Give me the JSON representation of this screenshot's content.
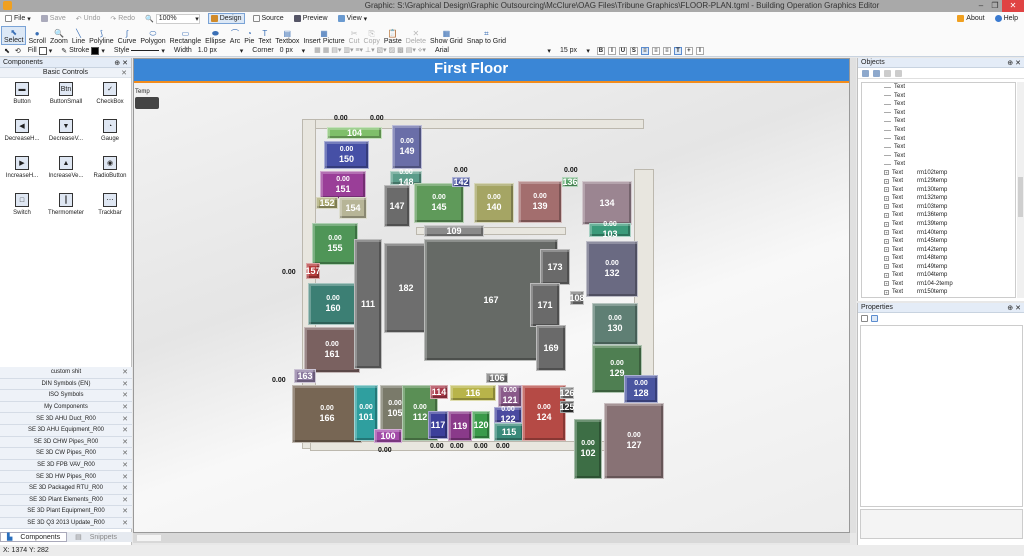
{
  "window": {
    "title": "Graphic: S:\\Graphical Design\\Graphic Outsourcing\\McClure\\OAG Files\\Tribune Graphics\\FLOOR-PLAN.tgml - Building Operation Graphics Editor",
    "minimize": "–",
    "maximize": "❐",
    "close": "✕"
  },
  "toolbar1": {
    "file": "File",
    "save": "Save",
    "undo": "Undo",
    "redo": "Redo",
    "zoom": "100%",
    "design": "Design",
    "source": "Source",
    "preview": "Preview",
    "view": "View",
    "about": "About",
    "help": "Help"
  },
  "tools": [
    {
      "label": "Select",
      "glyph": "⬉",
      "state": "active"
    },
    {
      "label": "Scroll",
      "glyph": "●",
      "state": "normal"
    },
    {
      "label": "Zoom",
      "glyph": "🔍",
      "state": "normal"
    },
    {
      "label": "Line",
      "glyph": "╲",
      "state": "normal"
    },
    {
      "label": "Polyline",
      "glyph": "⟆",
      "state": "normal"
    },
    {
      "label": "Curve",
      "glyph": "∫",
      "state": "normal"
    },
    {
      "label": "Polygon",
      "glyph": "⬭",
      "state": "normal"
    },
    {
      "label": "Rectangle",
      "glyph": "▭",
      "state": "normal"
    },
    {
      "label": "Ellipse",
      "glyph": "⬬",
      "state": "normal"
    },
    {
      "label": "Arc",
      "glyph": "⌒",
      "state": "normal"
    },
    {
      "label": "Pie",
      "glyph": "◔",
      "state": "normal"
    },
    {
      "label": "Text",
      "glyph": "T",
      "state": "normal"
    },
    {
      "label": "Textbox",
      "glyph": "▤",
      "state": "normal"
    },
    {
      "label": "Insert Picture",
      "glyph": "▦",
      "state": "normal"
    },
    {
      "label": "Cut",
      "glyph": "✂",
      "state": "disabled"
    },
    {
      "label": "Copy",
      "glyph": "⎘",
      "state": "disabled"
    },
    {
      "label": "Paste",
      "glyph": "📋",
      "state": "normal"
    },
    {
      "label": "Delete",
      "glyph": "✕",
      "state": "disabled"
    },
    {
      "label": "Show Grid",
      "glyph": "▦",
      "state": "normal"
    },
    {
      "label": "Snap to Grid",
      "glyph": "⌗",
      "state": "normal"
    }
  ],
  "toolbar3": {
    "fill": "Fill",
    "stroke": "Stroke",
    "style": "Style",
    "width_label": "Width",
    "width_value": "1.0 px",
    "corner_label": "Corner",
    "corner_value": "0 px",
    "font": "Arial",
    "font_size": "15 px",
    "format_buttons": [
      "B",
      "I",
      "U",
      "S",
      "≡",
      "≡",
      "≡",
      "T",
      "+",
      "I"
    ]
  },
  "components": {
    "title": "Components",
    "pin": "⊕",
    "close": "✕",
    "group": "Basic Controls",
    "controls": [
      {
        "label": "Button",
        "glyph": "▬"
      },
      {
        "label": "ButtonSmall",
        "glyph": "Btn"
      },
      {
        "label": "CheckBox",
        "glyph": "✓"
      },
      {
        "label": "DecreaseH...",
        "glyph": "◀"
      },
      {
        "label": "DecreaseV...",
        "glyph": "▼"
      },
      {
        "label": "Gauge",
        "glyph": "◔"
      },
      {
        "label": "IncreaseH...",
        "glyph": "▶"
      },
      {
        "label": "IncreaseVe...",
        "glyph": "▲"
      },
      {
        "label": "RadioButton",
        "glyph": "◉"
      },
      {
        "label": "Switch",
        "glyph": "□"
      },
      {
        "label": "Thermometer",
        "glyph": "┃"
      },
      {
        "label": "Trackbar",
        "glyph": "⋯"
      }
    ],
    "libraries": [
      "custom shit",
      "DIN Symbols (EN)",
      "ISO Symbols",
      "My Components",
      "SE 3D AHU Duct_R00",
      "SE 3D AHU Equipment_R00",
      "SE 3D CHW Pipes_R00",
      "SE 3D CW Pipes_R00",
      "SE 3D FPB VAV_R00",
      "SE 3D HW Pipes_R00",
      "SE 3D Packaged RTU_R00",
      "SE 3D Plant Elements_R00",
      "SE 3D Plant Equipment_R00",
      "SE 3D Q3 2013 Update_R00"
    ],
    "tabs": [
      "Components",
      "Snippets"
    ]
  },
  "status": {
    "coords": "X: 1374  Y: 282"
  },
  "canvas": {
    "banner_title": "First Floor",
    "temp_label": "Temp",
    "rooms": [
      {
        "n": "104",
        "v": "",
        "c": "#7fbf6a"
      },
      {
        "n": "149",
        "v": "0.00",
        "c": "#6a6ea8"
      },
      {
        "n": "150",
        "v": "0.00",
        "c": "#4650a6"
      },
      {
        "n": "148",
        "v": "0.00",
        "c": "#5b9c8a"
      },
      {
        "n": "151",
        "v": "0.00",
        "c": "#9a3e98"
      },
      {
        "n": "152",
        "v": "",
        "c": "#a8a770"
      },
      {
        "n": "154",
        "v": "",
        "c": "#b7b597"
      },
      {
        "n": "147",
        "v": "",
        "c": "#6b6b6b"
      },
      {
        "n": "145",
        "v": "0.00",
        "c": "#5f9a5a"
      },
      {
        "n": "142",
        "v": "",
        "c": "#4b56a3"
      },
      {
        "n": "140",
        "v": "0.00",
        "c": "#a5a564"
      },
      {
        "n": "139",
        "v": "0.00",
        "c": "#a36e6e"
      },
      {
        "n": "136",
        "v": "",
        "c": "#5aa46a"
      },
      {
        "n": "134",
        "v": "",
        "c": "#9b8591"
      },
      {
        "n": "103",
        "v": "0.00",
        "c": "#3b9a7a"
      },
      {
        "n": "155",
        "v": "0.00",
        "c": "#4f9557"
      },
      {
        "n": "157",
        "v": "",
        "c": "#b43a3a"
      },
      {
        "n": "160",
        "v": "0.00",
        "c": "#3c7f74"
      },
      {
        "n": "161",
        "v": "0.00",
        "c": "#7a6160"
      },
      {
        "n": "111",
        "v": "",
        "c": "#6e6e6e"
      },
      {
        "n": "182",
        "v": "",
        "c": "#6e6e6e"
      },
      {
        "n": "167",
        "v": "",
        "c": "#666a66"
      },
      {
        "n": "109",
        "v": "",
        "c": "#8a8a8a"
      },
      {
        "n": "173",
        "v": "",
        "c": "#6a6a6a"
      },
      {
        "n": "171",
        "v": "",
        "c": "#6a6a6a"
      },
      {
        "n": "169",
        "v": "",
        "c": "#6a6a6a"
      },
      {
        "n": "108",
        "v": "",
        "c": "#7a7a7a"
      },
      {
        "n": "132",
        "v": "0.00",
        "c": "#6a6a82"
      },
      {
        "n": "130",
        "v": "0.00",
        "c": "#5f7f74"
      },
      {
        "n": "129",
        "v": "0.00",
        "c": "#4f7f52"
      },
      {
        "n": "163",
        "v": "",
        "c": "#8c7aa0"
      },
      {
        "n": "166",
        "v": "0.00",
        "c": "#776654"
      },
      {
        "n": "101",
        "v": "0.00",
        "c": "#2f9f9f"
      },
      {
        "n": "105",
        "v": "0.00",
        "c": "#7a7a6a"
      },
      {
        "n": "100",
        "v": "",
        "c": "#a24aa8"
      },
      {
        "n": "112",
        "v": "0.00",
        "c": "#5a8f55"
      },
      {
        "n": "114",
        "v": "",
        "c": "#a83a4a"
      },
      {
        "n": "116",
        "v": "",
        "c": "#b8b44a"
      },
      {
        "n": "106",
        "v": "",
        "c": "#777"
      },
      {
        "n": "117",
        "v": "",
        "c": "#3c3f9a"
      },
      {
        "n": "119",
        "v": "",
        "c": "#8a3a8a"
      },
      {
        "n": "120",
        "v": "",
        "c": "#3a9a4a"
      },
      {
        "n": "121",
        "v": "0.00",
        "c": "#8a5a8a"
      },
      {
        "n": "122",
        "v": "0.00",
        "c": "#4a4aa0"
      },
      {
        "n": "115",
        "v": "",
        "c": "#3a8a7a"
      },
      {
        "n": "124",
        "v": "0.00",
        "c": "#b54a45"
      },
      {
        "n": "126",
        "v": "",
        "c": "#777"
      },
      {
        "n": "125",
        "v": "",
        "c": "#333"
      },
      {
        "n": "102",
        "v": "0.00",
        "c": "#3d6e45"
      },
      {
        "n": "128",
        "v": "0.00",
        "c": "#4a55a0"
      },
      {
        "n": "127",
        "v": "0.00",
        "c": "#887275"
      }
    ],
    "floating_values": [
      "0.00",
      "0.00",
      "0.00",
      "0.00",
      "0.00",
      "0.00",
      "0.00",
      "0.00",
      "0.00",
      "0.00",
      "0.00"
    ]
  },
  "objects": {
    "title": "Objects",
    "rows": [
      {
        "type": "Text",
        "name": ""
      },
      {
        "type": "Text",
        "name": ""
      },
      {
        "type": "Text",
        "name": ""
      },
      {
        "type": "Text",
        "name": ""
      },
      {
        "type": "Text",
        "name": ""
      },
      {
        "type": "Text",
        "name": ""
      },
      {
        "type": "Text",
        "name": ""
      },
      {
        "type": "Text",
        "name": ""
      },
      {
        "type": "Text",
        "name": ""
      },
      {
        "type": "Text",
        "name": ""
      },
      {
        "type": "Text",
        "name": "rm102temp"
      },
      {
        "type": "Text",
        "name": "rm129temp"
      },
      {
        "type": "Text",
        "name": "rm130temp"
      },
      {
        "type": "Text",
        "name": "rm132temp"
      },
      {
        "type": "Text",
        "name": "rm103temp"
      },
      {
        "type": "Text",
        "name": "rm136temp"
      },
      {
        "type": "Text",
        "name": "rm139temp"
      },
      {
        "type": "Text",
        "name": "rm140temp"
      },
      {
        "type": "Text",
        "name": "rm145temp"
      },
      {
        "type": "Text",
        "name": "rm142temp"
      },
      {
        "type": "Text",
        "name": "rm148temp"
      },
      {
        "type": "Text",
        "name": "rm149temp"
      },
      {
        "type": "Text",
        "name": "rm104temp"
      },
      {
        "type": "Text",
        "name": "rm104-2temp"
      },
      {
        "type": "Text",
        "name": "rm150temp"
      }
    ]
  },
  "properties": {
    "title": "Properties"
  }
}
